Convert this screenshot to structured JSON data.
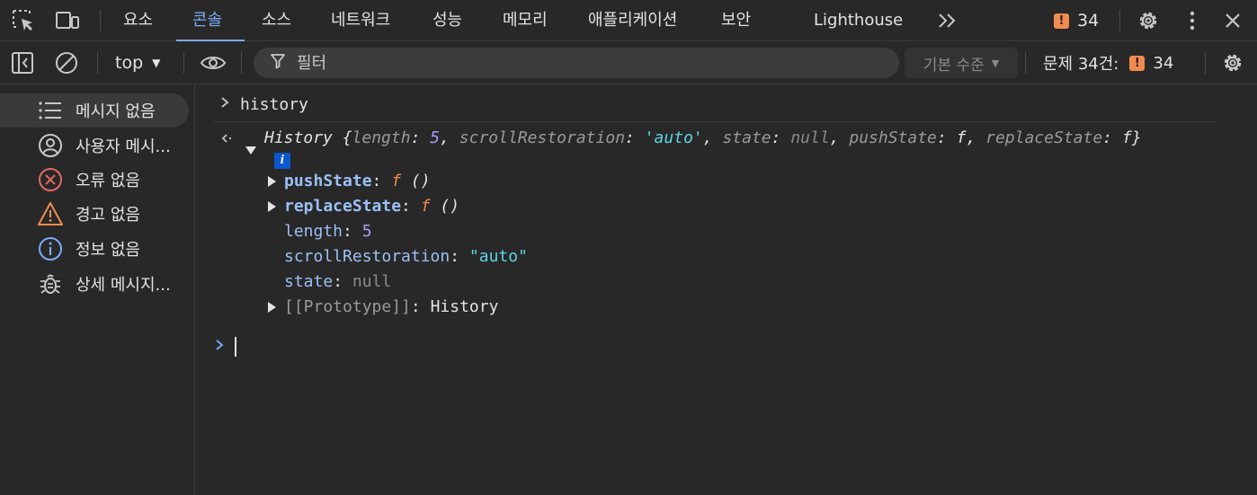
{
  "tabs": {
    "items": [
      "요소",
      "콘솔",
      "소스",
      "네트워크",
      "성능",
      "메모리",
      "애플리케이션",
      "보안",
      "Lighthouse"
    ],
    "active": "콘솔",
    "issue_count": "34"
  },
  "toolbar": {
    "context": "top",
    "filter_placeholder": "필터",
    "levels": "기본 수준",
    "issues_label": "문제 34건:",
    "issues_count": "34"
  },
  "sidebar": {
    "items": [
      {
        "label": "메시지 없음",
        "icon": "list-icon",
        "active": true
      },
      {
        "label": "사용자 메시...",
        "icon": "user-icon"
      },
      {
        "label": "오류 없음",
        "icon": "error-icon"
      },
      {
        "label": "경고 없음",
        "icon": "warning-icon"
      },
      {
        "label": "정보 없음",
        "icon": "info-icon"
      },
      {
        "label": "상세 메시지...",
        "icon": "bug-icon"
      }
    ]
  },
  "console": {
    "command": "history",
    "result_summary": {
      "type": "History",
      "length_key": "length",
      "length_val": "5",
      "scroll_key": "scrollRestoration",
      "scroll_val": "'auto'",
      "state_key": "state",
      "state_val": "null",
      "push_key": "pushState",
      "push_val": "f",
      "replace_key": "replaceState",
      "replace_val": "f"
    },
    "props": {
      "pushState": "pushState",
      "replaceState": "replaceState",
      "fn_marker": "f",
      "fn_parens": "()",
      "length": "length",
      "length_val": "5",
      "scrollRestoration": "scrollRestoration",
      "scrollRestoration_val": "\"auto\"",
      "state": "state",
      "state_val": "null",
      "prototype": "[[Prototype]]",
      "prototype_val": "History"
    }
  },
  "colors": {
    "accent": "#7cacf8",
    "issue": "#f28b50",
    "error": "#e46962",
    "warning": "#f28b50",
    "info": "#7cacf8"
  }
}
